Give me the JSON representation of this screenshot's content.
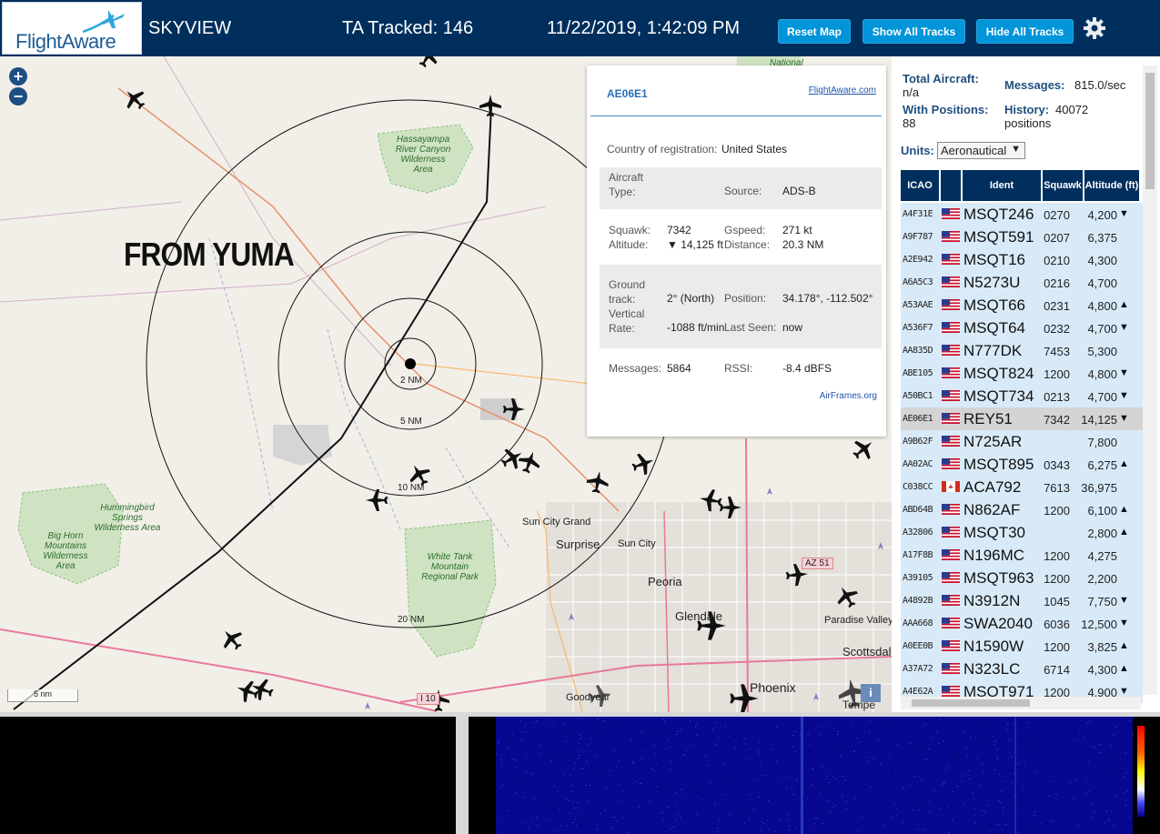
{
  "header": {
    "logo_text": "FlightAware",
    "app_name": "SKYVIEW",
    "tracked_label": "TA Tracked: 146",
    "datetime": "11/22/2019, 1:42:09 PM",
    "buttons": {
      "reset_map": "Reset Map",
      "show_all_tracks": "Show All Tracks",
      "hide_all_tracks": "Hide All Tracks"
    }
  },
  "map": {
    "zoom_in": "+",
    "zoom_out": "−",
    "annotation": "FROM YUMA",
    "range_rings": [
      "2 NM",
      "5 NM",
      "10 NM",
      "20 NM"
    ],
    "scale": "5 nm",
    "info_button": "i",
    "places": [
      "Sun City Grand",
      "Surprise",
      "Sun City",
      "Peoria",
      "Glendale",
      "Paradise Valley",
      "Scottsdale",
      "Phoenix",
      "Goodyear",
      "Tempe",
      "AZ 51",
      "I 10",
      "National"
    ],
    "parks": [
      "Hassayampa River Canyon Wilderness Area",
      "Hummingbird Springs Wilderness Area",
      "Big Horn Mountains Wilderness Area",
      "White Tank Mountain Regional Park"
    ]
  },
  "popup": {
    "icao": "AE06E1",
    "fa_link": "FlightAware.com",
    "country_label": "Country of registration:",
    "country_value": "United States",
    "aircraft_type_label": "Aircraft Type:",
    "aircraft_type_value": "",
    "source_label": "Source:",
    "source_value": "ADS-B",
    "squawk_label": "Squawk:",
    "squawk_value": "7342",
    "altitude_label": "Altitude:",
    "altitude_value": "▼ 14,125 ft",
    "gspeed_label": "Gspeed:",
    "gspeed_value": "271 kt",
    "distance_label": "Distance:",
    "distance_value": "20.3 NM",
    "track_label": "Ground track:",
    "track_value": "2° (North)",
    "position_label": "Position:",
    "position_value": "34.178°, -112.502°",
    "vrate_label": "Vertical Rate:",
    "vrate_value": "-1088 ft/min",
    "lastseen_label": "Last Seen:",
    "lastseen_value": "now",
    "messages_label": "Messages:",
    "messages_value": "5864",
    "rssi_label": "RSSI:",
    "rssi_value": "-8.4 dBFS",
    "airframes_link": "AirFrames.org"
  },
  "stats": {
    "total_aircraft_label": "Total Aircraft:",
    "total_aircraft_value": "n/a",
    "messages_label": "Messages:",
    "messages_value": "815.0/sec",
    "with_positions_label": "With Positions:",
    "with_positions_value": "88",
    "history_label": "History:",
    "history_value": "40072",
    "history_unit": "positions",
    "units_label": "Units:",
    "units_value": "Aeronautical"
  },
  "table": {
    "headers": [
      "ICAO",
      "Ident",
      "Squawk",
      "Altitude (ft)"
    ],
    "rows": [
      {
        "icao": "A4F31E",
        "flag": "us",
        "ident": "MSQT246",
        "squawk": "0270",
        "alt": "4,200",
        "trend": "▼",
        "selected": false
      },
      {
        "icao": "A9F787",
        "flag": "us",
        "ident": "MSQT591",
        "squawk": "0207",
        "alt": "6,375",
        "trend": "",
        "selected": false
      },
      {
        "icao": "A2E942",
        "flag": "us",
        "ident": "MSQT16",
        "squawk": "0210",
        "alt": "4,300",
        "trend": "",
        "selected": false
      },
      {
        "icao": "A6A5C3",
        "flag": "us",
        "ident": "N5273U",
        "squawk": "0216",
        "alt": "4,700",
        "trend": "",
        "selected": false
      },
      {
        "icao": "A53AAE",
        "flag": "us",
        "ident": "MSQT66",
        "squawk": "0231",
        "alt": "4,800",
        "trend": "▲",
        "selected": false
      },
      {
        "icao": "A536F7",
        "flag": "us",
        "ident": "MSQT64",
        "squawk": "0232",
        "alt": "4,700",
        "trend": "▼",
        "selected": false
      },
      {
        "icao": "AA835D",
        "flag": "us",
        "ident": "N777DK",
        "squawk": "7453",
        "alt": "5,300",
        "trend": "",
        "selected": false
      },
      {
        "icao": "ABE105",
        "flag": "us",
        "ident": "MSQT824",
        "squawk": "1200",
        "alt": "4,800",
        "trend": "▼",
        "selected": false
      },
      {
        "icao": "A50BC1",
        "flag": "us",
        "ident": "MSQT734",
        "squawk": "0213",
        "alt": "4,700",
        "trend": "▼",
        "selected": false
      },
      {
        "icao": "AE06E1",
        "flag": "us",
        "ident": "REY51",
        "squawk": "7342",
        "alt": "14,125",
        "trend": "▼",
        "selected": true
      },
      {
        "icao": "A9B62F",
        "flag": "us",
        "ident": "N725AR",
        "squawk": "",
        "alt": "7,800",
        "trend": "",
        "selected": false
      },
      {
        "icao": "AA02AC",
        "flag": "us",
        "ident": "MSQT895",
        "squawk": "0343",
        "alt": "6,275",
        "trend": "▲",
        "selected": false
      },
      {
        "icao": "C038CC",
        "flag": "ca",
        "ident": "ACA792",
        "squawk": "7613",
        "alt": "36,975",
        "trend": "",
        "selected": false
      },
      {
        "icao": "ABD64B",
        "flag": "us",
        "ident": "N862AF",
        "squawk": "1200",
        "alt": "6,100",
        "trend": "▲",
        "selected": false
      },
      {
        "icao": "A32806",
        "flag": "us",
        "ident": "MSQT30",
        "squawk": "",
        "alt": "2,800",
        "trend": "▲",
        "selected": false
      },
      {
        "icao": "A17F8B",
        "flag": "us",
        "ident": "N196MC",
        "squawk": "1200",
        "alt": "4,275",
        "trend": "",
        "selected": false
      },
      {
        "icao": "A39105",
        "flag": "us",
        "ident": "MSQT963",
        "squawk": "1200",
        "alt": "2,200",
        "trend": "",
        "selected": false
      },
      {
        "icao": "A4892B",
        "flag": "us",
        "ident": "N3912N",
        "squawk": "1045",
        "alt": "7,750",
        "trend": "▼",
        "selected": false
      },
      {
        "icao": "AAA668",
        "flag": "us",
        "ident": "SWA2040",
        "squawk": "6036",
        "alt": "12,500",
        "trend": "▼",
        "selected": false
      },
      {
        "icao": "A0EE0B",
        "flag": "us",
        "ident": "N1590W",
        "squawk": "1200",
        "alt": "3,825",
        "trend": "▲",
        "selected": false
      },
      {
        "icao": "A37A72",
        "flag": "us",
        "ident": "N323LC",
        "squawk": "6714",
        "alt": "4,300",
        "trend": "▲",
        "selected": false
      },
      {
        "icao": "A4E62A",
        "flag": "us",
        "ident": "MSQT971",
        "squawk": "1200",
        "alt": "4,900",
        "trend": "▼",
        "selected": false
      }
    ]
  },
  "colors": {
    "header_bg": "#002f5d",
    "button": "#0094d9",
    "row_bg": "#d8eaf8",
    "row_selected": "#d4d4d4"
  }
}
